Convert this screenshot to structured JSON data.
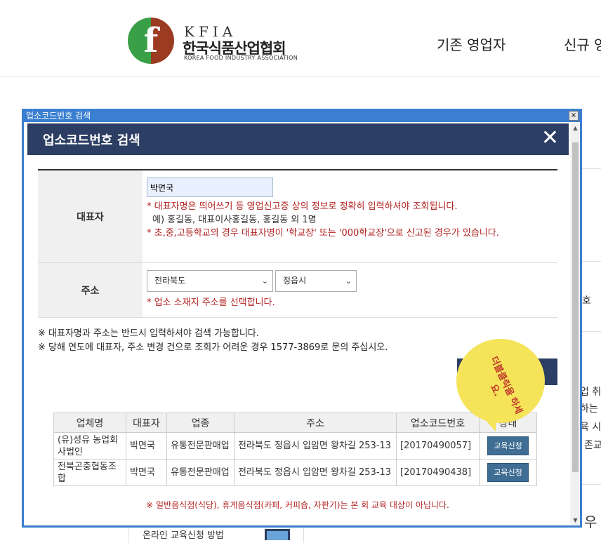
{
  "site": {
    "logo_en": "KFIA",
    "logo_ko": "한국식품산업협회",
    "logo_sub": "KOREA FOOD INDUSTRY ASSOCIATION",
    "logo_letter": "f",
    "nav": [
      "기존 영업자",
      "신규 영"
    ],
    "background_fragments": [
      "호",
      "업 취",
      "하는",
      "육 시",
      "존교",
      "우",
      "온라인 교육신청 방법"
    ]
  },
  "window": {
    "title": "업소코드번호 검색",
    "close": "×"
  },
  "modal": {
    "title": "업소코드번호 검색",
    "close": "✕"
  },
  "form": {
    "representative": {
      "label": "대표자",
      "value": "박면국",
      "note1": "* 대표자명은 띄어쓰기 등 영업신고증 상의 정보로 정확히 입력하셔야 조회됩니다.",
      "example": "예) 홍길동, 대표이사홍길동, 홍길동 외 1명",
      "note2": "* 초,중,고등학교의 경우 대표자명이 '학교장' 또는 '000학교장'으로 신고된 경우가 있습니다."
    },
    "address": {
      "label": "주소",
      "province": "전라북도",
      "city": "정읍시",
      "note": "* 업소 소재지 주소를 선택합니다."
    }
  },
  "notes": [
    "※ 대표자명과 주소는 반드시 입력하셔야 검색 가능합니다.",
    "※ 당해 연도에 대표자, 주소 변경 건으로 조회가 어려운 경우 1577-3869로 문의 주십시오."
  ],
  "bubble": {
    "text": "더블클릭을 하세요."
  },
  "results": {
    "headers": [
      "업체명",
      "대표자",
      "업종",
      "주소",
      "업소코드번호",
      "상태"
    ],
    "rows": [
      {
        "name": "(유)성유 농업회사법인",
        "rep": "박면국",
        "type": "유통전문판매업",
        "address": "전라북도 정읍시 입암면 왕차길 253-13",
        "code": "[20170490057]",
        "action": "교육신청"
      },
      {
        "name": "전북곤충협동조합",
        "rep": "박면국",
        "type": "유통전문판매업",
        "address": "전라북도 정읍시 입암면 왕차길 253-13",
        "code": "[20170490438]",
        "action": "교육신청"
      }
    ]
  },
  "bottom_note": "※ 일반음식점(식당), 휴게음식점(카페, 커피숍, 자판기)는 본 회 교육 대상이 아닙니다.",
  "colors": {
    "header_navy": "#2c3e63",
    "window_blue": "#3a7fd0",
    "warning_red": "#b22222",
    "button_blue": "#3f6d94",
    "bubble_yellow": "#f5e35a"
  }
}
